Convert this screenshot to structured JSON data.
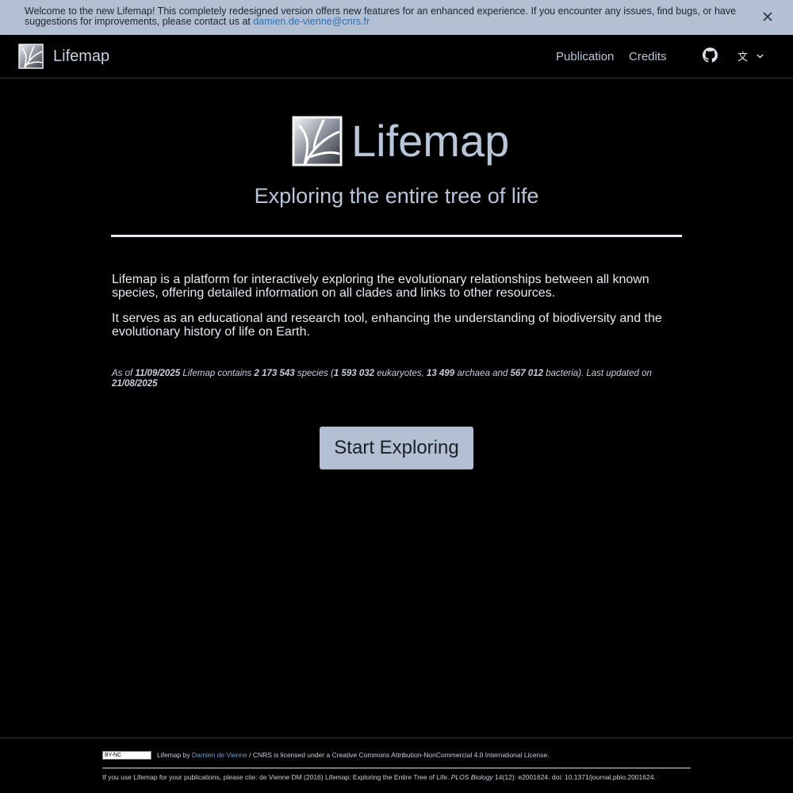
{
  "banner": {
    "text": "Welcome to the new Lifemap! This completely redesigned version offers new features for an enhanced experience. If you encounter any issues, find bugs, or have suggestions for improvements, please contact us at",
    "email": "damien.de-vienne@cnrs.fr",
    "close_icon": "close-icon"
  },
  "nav": {
    "brand": "Lifemap",
    "links": [
      "Publication",
      "Credits"
    ],
    "github_icon": "github-icon",
    "language_icon": "translate-icon"
  },
  "hero": {
    "title": "Lifemap",
    "subtitle": "Exploring the entire tree of life"
  },
  "description": {
    "p1": "Lifemap is a platform for interactively exploring the evolutionary relationships between all known species, offering detailed information on all clades and links to other resources.",
    "p2": "It serves as an educational and research tool, enhancing the understanding of biodiversity and the evolutionary history of life on Earth."
  },
  "stats": {
    "as_of": "As of",
    "date": "11/09/2025",
    "contains": "Lifemap contains",
    "species": "2 173 543",
    "species_label": "species (",
    "eukaryotes": "1 593 032",
    "eukaryotes_label": "eukaryotes,",
    "archaea": "13 499",
    "archaea_label": "archaea and",
    "bacteria": "567 012",
    "bacteria_label": "bacteria). Last updated on",
    "updated": "21/08/2025"
  },
  "cta": {
    "label": "Start Exploring"
  },
  "footer": {
    "cc_badge": "BY-NC",
    "line1_prefix": "Lifemap by",
    "author": "Damien de Vienne",
    "line1_suffix": "/ CNRS is licensed under a Creative Commons Attribution-NonCommercial 4.0 International License.",
    "line2_prefix": "If you use Lifemap for your publications, please cite: de Vienne DM (2016) Lifemap: Exploring the Entire Tree of Life.",
    "journal": "PLOS Biology",
    "line2_suffix": "14(12): e2001624. doi: 10.1371/journal.pbio.2001624."
  },
  "colors": {
    "background": "#000000",
    "banner": "#b3bfd3",
    "accent_text": "#b9c6da",
    "link": "#6fa0d8"
  }
}
